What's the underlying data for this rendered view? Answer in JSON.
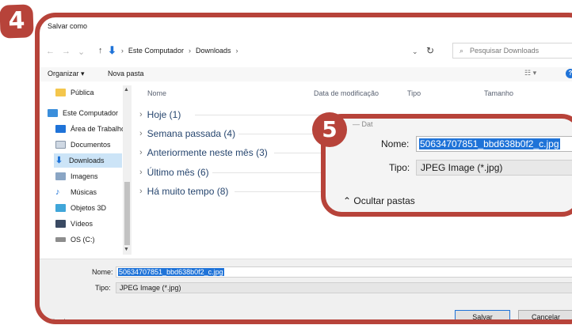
{
  "dialog": {
    "title": "Salvar como",
    "address": {
      "crumbs": [
        "Este Computador",
        "Downloads"
      ],
      "search_placeholder": "Pesquisar Downloads"
    },
    "toolbar": {
      "organize_label": "Organizar ▾",
      "new_folder_label": "Nova pasta"
    },
    "sidebar": {
      "items": [
        {
          "label": "Pública",
          "icon": "folder-icon"
        },
        {
          "label": "Este Computador",
          "icon": "computer-icon"
        },
        {
          "label": "Área de Trabalho",
          "icon": "desktop-icon"
        },
        {
          "label": "Documentos",
          "icon": "documents-icon"
        },
        {
          "label": "Downloads",
          "icon": "downloads-icon",
          "selected": true
        },
        {
          "label": "Imagens",
          "icon": "images-icon"
        },
        {
          "label": "Músicas",
          "icon": "music-icon"
        },
        {
          "label": "Objetos 3D",
          "icon": "objects-3d-icon"
        },
        {
          "label": "Vídeos",
          "icon": "videos-icon"
        },
        {
          "label": "OS (C:)",
          "icon": "drive-icon"
        }
      ]
    },
    "columns": [
      "Nome",
      "Data de modificação",
      "Tipo",
      "Tamanho"
    ],
    "groups": [
      "Hoje (1)",
      "Semana passada (4)",
      "Anteriormente neste mês (3)",
      "Último mês (6)",
      "Há muito tempo (8)"
    ],
    "form": {
      "name_label": "Nome:",
      "name_value": "50634707851_bbd638b0f2_c.jpg",
      "type_label": "Tipo:",
      "type_value": "JPEG Image (*.jpg)"
    },
    "hide_folders_label": "Ocultar pastas",
    "save_label": "Salvar",
    "cancel_label": "Cancelar"
  },
  "zoom": {
    "name_label": "Nome:",
    "name_value": "50634707851_bbd638b0f2_c.jpg",
    "type_label": "Tipo:",
    "type_value": "JPEG Image (*.jpg)",
    "hide_folders_label": "Ocultar pastas"
  },
  "badges": {
    "step4": "4",
    "step5": "5"
  },
  "colors": {
    "accent": "#b7433a",
    "selection": "#1f73d8"
  }
}
